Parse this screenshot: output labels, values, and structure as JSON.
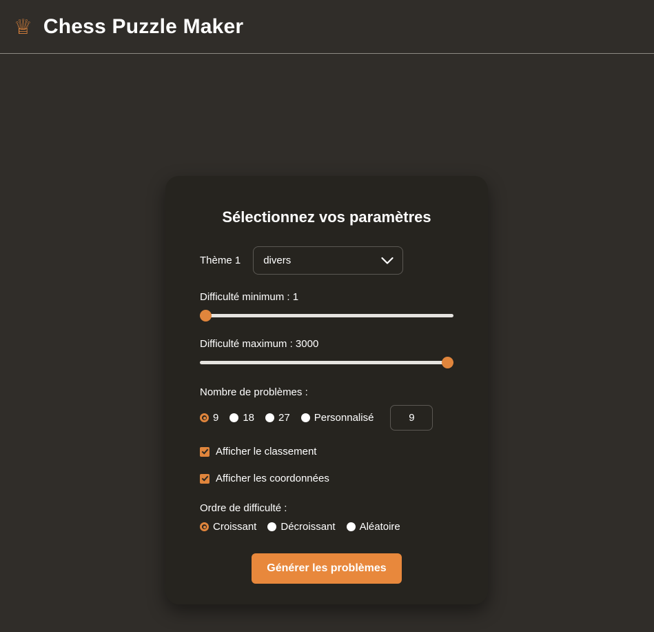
{
  "header": {
    "icon": "chess-queen-crown-icon",
    "title": "Chess Puzzle Maker",
    "accent_color": "#e0853c",
    "background_color": "#302d29"
  },
  "card": {
    "title": "Sélectionnez vos paramètres",
    "background_color": "#26241f",
    "theme": {
      "label": "Thème 1",
      "selected": "divers",
      "options": [
        "divers"
      ],
      "chevron_icon": "chevron-down-icon"
    },
    "difficulty_min": {
      "label": "Difficulté minimum : 1",
      "value": 1,
      "min": 1,
      "max": 3000
    },
    "difficulty_max": {
      "label": "Difficulté maximum : 3000",
      "value": 3000,
      "min": 1,
      "max": 3000
    },
    "problem_count": {
      "title": "Nombre de problèmes :",
      "options": [
        {
          "label": "9",
          "checked": true
        },
        {
          "label": "18",
          "checked": false
        },
        {
          "label": "27",
          "checked": false
        },
        {
          "label": "Personnalisé",
          "checked": false
        }
      ],
      "custom_value": "9"
    },
    "checkboxes": [
      {
        "label": "Afficher le classement",
        "checked": true
      },
      {
        "label": "Afficher les coordonnées",
        "checked": true
      }
    ],
    "difficulty_order": {
      "title": "Ordre de difficulté :",
      "options": [
        {
          "label": "Croissant",
          "checked": true
        },
        {
          "label": "Décroissant",
          "checked": false
        },
        {
          "label": "Aléatoire",
          "checked": false
        }
      ]
    },
    "submit_label": "Générer les problèmes",
    "submit_color": "#e8883c"
  }
}
